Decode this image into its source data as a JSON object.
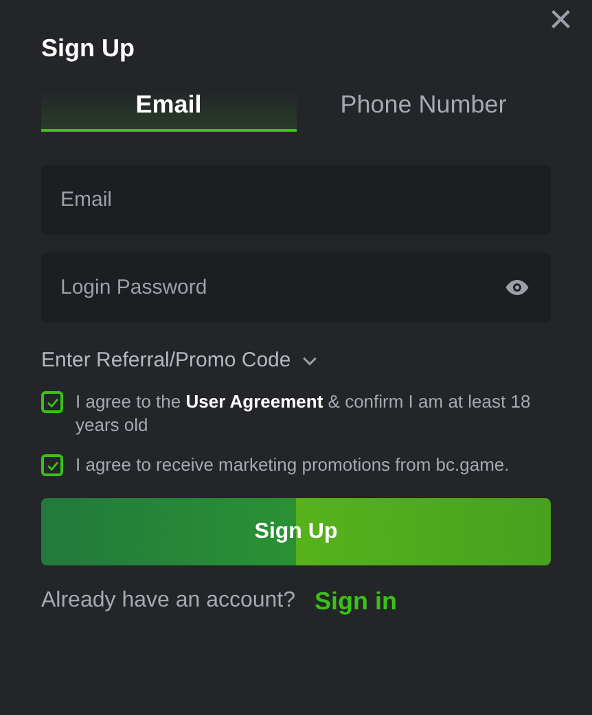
{
  "dialog": {
    "title": "Sign Up",
    "close": "×"
  },
  "tabs": [
    {
      "label": "Email",
      "selected": true
    },
    {
      "label": "Phone Number",
      "selected": false
    }
  ],
  "fields": [
    {
      "kind": "text",
      "placeholder": "Email"
    },
    {
      "kind": "password",
      "placeholder": "Login Password"
    }
  ],
  "promo_toggle": {
    "label": "Enter Referral/Promo Code",
    "expanded": false
  },
  "agreements": [
    {
      "text": "I agree to the **User Agreement** & confirm I am at least 18 years old",
      "checked": true
    },
    {
      "text": "I agree to receive marketing promotions from bc.game.",
      "checked": true
    }
  ],
  "submit_button": "Sign Up",
  "footer": {
    "prompt": "Already have an account?",
    "link": "Sign in"
  }
}
